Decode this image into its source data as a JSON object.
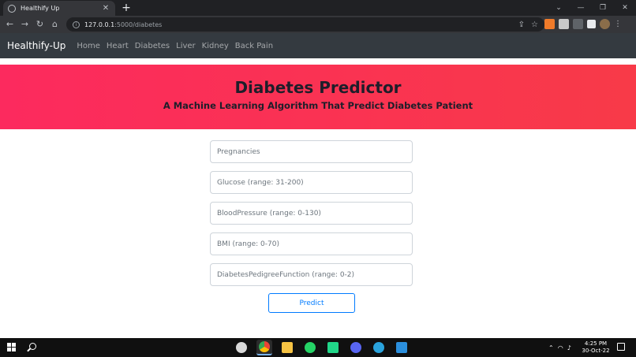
{
  "browser": {
    "tab_title": "Healthify Up",
    "tab_close": "✕",
    "new_tab": "+",
    "url_host": "127.0.0.1",
    "url_path": ":5000/diabetes"
  },
  "navbar": {
    "brand": "Healthify-Up",
    "links": [
      "Home",
      "Heart",
      "Diabetes",
      "Liver",
      "Kidney",
      "Back Pain"
    ]
  },
  "hero": {
    "title": "Diabetes Predictor",
    "subtitle": "A Machine Learning Algorithm That Predict Diabetes Patient"
  },
  "form": {
    "fields": [
      {
        "placeholder": "Pregnancies"
      },
      {
        "placeholder": "Glucose (range: 31-200)"
      },
      {
        "placeholder": "BloodPressure (range: 0-130)"
      },
      {
        "placeholder": "BMI (range: 0-70)"
      },
      {
        "placeholder": "DiabetesPedigreeFunction (range: 0-2)"
      }
    ],
    "submit_label": "Predict"
  },
  "taskbar": {
    "time": "4:25 PM",
    "date": "30-Oct-22"
  },
  "colors": {
    "navbar_bg": "#343a40",
    "hero_start": "#fc2a5e",
    "hero_end": "#f83a48",
    "button_accent": "#007bff"
  }
}
